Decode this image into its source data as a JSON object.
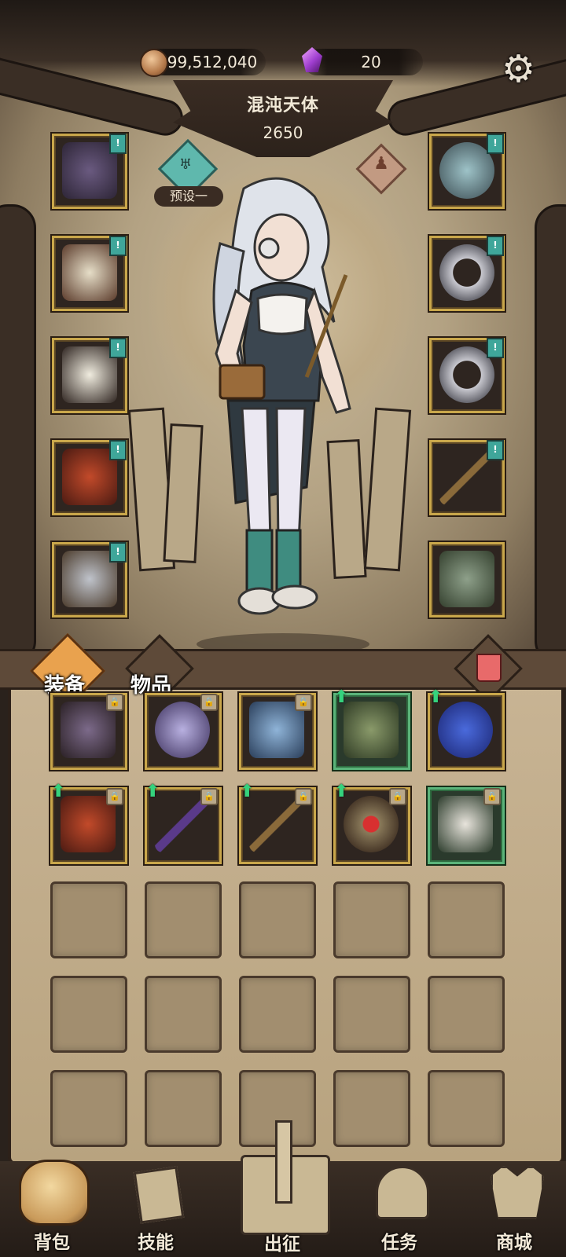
{
  "currency": {
    "gold": "99,512,040",
    "gems": "20"
  },
  "header": {
    "title": "混沌天体",
    "power": "2650"
  },
  "preset": {
    "label": "预设一"
  },
  "tabs": {
    "equipment": "装备",
    "items": "物品"
  },
  "nav": [
    {
      "label": "背包"
    },
    {
      "label": "技能"
    },
    {
      "label": "出征"
    },
    {
      "label": "任务"
    },
    {
      "label": "商城"
    }
  ],
  "equipped_left": [
    "cage-helm",
    "cloak-armor",
    "white-scarf",
    "red-cape",
    "spiked-greaves"
  ],
  "equipped_right": [
    "pocket-watch",
    "silver-ring",
    "silver-ring",
    "wooden-staff",
    "green-gauntlet"
  ],
  "colors": {
    "accent_green": "#35d27d",
    "flag_teal": "#3fa69a",
    "frame_gold": "#c9a74b",
    "trash_red": "#e86a6a"
  }
}
